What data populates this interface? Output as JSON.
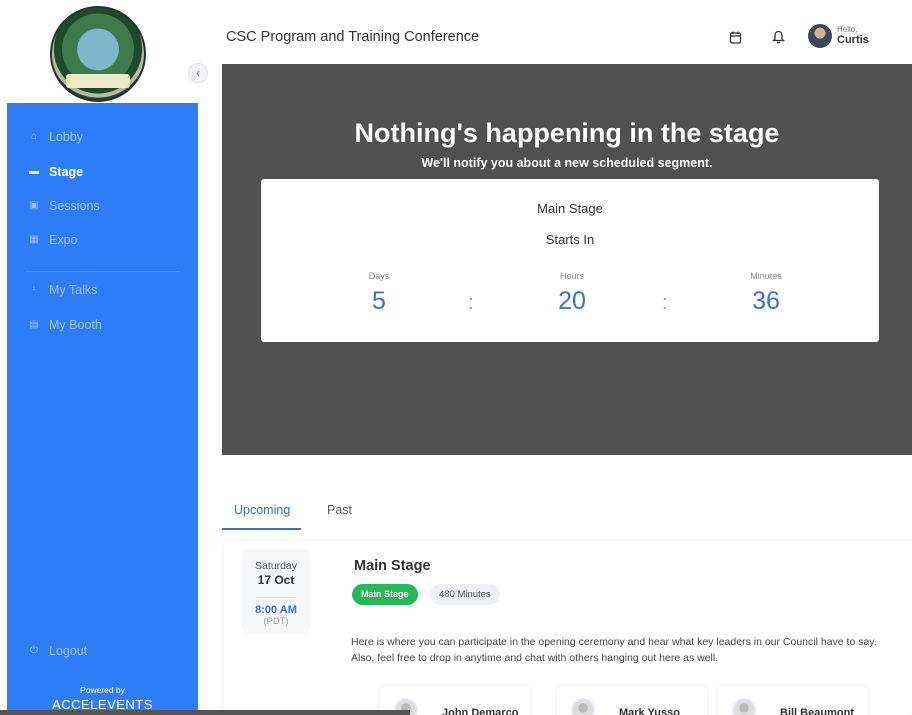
{
  "header": {
    "event_title": "CSC Program and Training Conference",
    "greeting": "Hello,",
    "user_name": "Curtis"
  },
  "sidebar": {
    "items": [
      {
        "label": "Lobby",
        "icon": "home-icon",
        "active": false
      },
      {
        "label": "Stage",
        "icon": "stage-icon",
        "active": true
      },
      {
        "label": "Sessions",
        "icon": "calendar-icon",
        "active": false
      },
      {
        "label": "Expo",
        "icon": "grid-icon",
        "active": false
      },
      {
        "label": "My Talks",
        "icon": "microphone-icon",
        "active": false
      },
      {
        "label": "My Booth",
        "icon": "booth-icon",
        "active": false
      }
    ],
    "logout": "Logout",
    "powered_by": "Powered by",
    "brand": "ACCELEVENTS"
  },
  "stage": {
    "title": "Nothing's happening in the stage",
    "subtitle": "We'll notify you about a new scheduled segment.",
    "countdown": {
      "stage_name": "Main Stage",
      "starts_in": "Starts In",
      "days_label": "Days",
      "days": "5",
      "hours_label": "Hours",
      "hours": "20",
      "minutes_label": "Minutes",
      "minutes": "36",
      "separator": ":"
    }
  },
  "tabs": [
    {
      "label": "Upcoming",
      "active": true
    },
    {
      "label": "Past",
      "active": false
    }
  ],
  "session": {
    "weekday": "Saturday",
    "date": "17 Oct",
    "time": "8:00 AM",
    "timezone": "(PDT)",
    "title": "Main Stage",
    "track": "Main Stage",
    "duration": "480 Minutes",
    "description": "Here is where you can participate in the opening ceremony and hear what key leaders in our Council have to say. Also, feel free to drop in anytime and chat with others hanging out here as well.",
    "speakers": [
      "John Demarco",
      "Mark Yusso",
      "Bill Beaumont"
    ]
  },
  "colors": {
    "sidebar": "#2e7cf6",
    "stage_bg": "#505050",
    "accent": "#3a6fd6",
    "track_badge": "#27b75b"
  }
}
